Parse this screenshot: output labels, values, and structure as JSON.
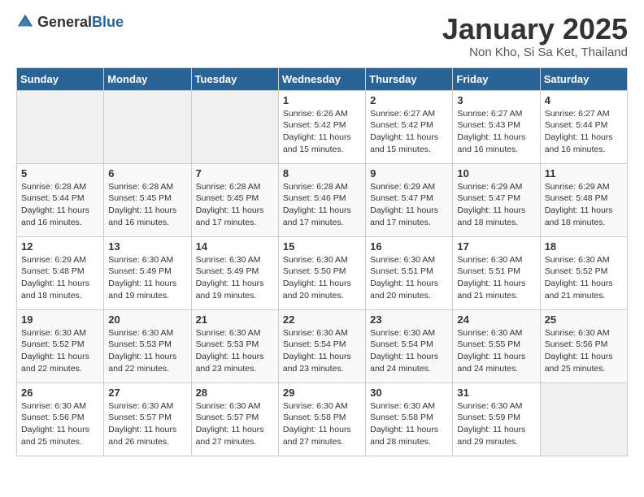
{
  "logo": {
    "general": "General",
    "blue": "Blue"
  },
  "title": "January 2025",
  "subtitle": "Non Kho, Si Sa Ket, Thailand",
  "days_of_week": [
    "Sunday",
    "Monday",
    "Tuesday",
    "Wednesday",
    "Thursday",
    "Friday",
    "Saturday"
  ],
  "weeks": [
    [
      {
        "day": "",
        "info": ""
      },
      {
        "day": "",
        "info": ""
      },
      {
        "day": "",
        "info": ""
      },
      {
        "day": "1",
        "info": "Sunrise: 6:26 AM\nSunset: 5:42 PM\nDaylight: 11 hours and 15 minutes."
      },
      {
        "day": "2",
        "info": "Sunrise: 6:27 AM\nSunset: 5:42 PM\nDaylight: 11 hours and 15 minutes."
      },
      {
        "day": "3",
        "info": "Sunrise: 6:27 AM\nSunset: 5:43 PM\nDaylight: 11 hours and 16 minutes."
      },
      {
        "day": "4",
        "info": "Sunrise: 6:27 AM\nSunset: 5:44 PM\nDaylight: 11 hours and 16 minutes."
      }
    ],
    [
      {
        "day": "5",
        "info": "Sunrise: 6:28 AM\nSunset: 5:44 PM\nDaylight: 11 hours and 16 minutes."
      },
      {
        "day": "6",
        "info": "Sunrise: 6:28 AM\nSunset: 5:45 PM\nDaylight: 11 hours and 16 minutes."
      },
      {
        "day": "7",
        "info": "Sunrise: 6:28 AM\nSunset: 5:45 PM\nDaylight: 11 hours and 17 minutes."
      },
      {
        "day": "8",
        "info": "Sunrise: 6:28 AM\nSunset: 5:46 PM\nDaylight: 11 hours and 17 minutes."
      },
      {
        "day": "9",
        "info": "Sunrise: 6:29 AM\nSunset: 5:47 PM\nDaylight: 11 hours and 17 minutes."
      },
      {
        "day": "10",
        "info": "Sunrise: 6:29 AM\nSunset: 5:47 PM\nDaylight: 11 hours and 18 minutes."
      },
      {
        "day": "11",
        "info": "Sunrise: 6:29 AM\nSunset: 5:48 PM\nDaylight: 11 hours and 18 minutes."
      }
    ],
    [
      {
        "day": "12",
        "info": "Sunrise: 6:29 AM\nSunset: 5:48 PM\nDaylight: 11 hours and 18 minutes."
      },
      {
        "day": "13",
        "info": "Sunrise: 6:30 AM\nSunset: 5:49 PM\nDaylight: 11 hours and 19 minutes."
      },
      {
        "day": "14",
        "info": "Sunrise: 6:30 AM\nSunset: 5:49 PM\nDaylight: 11 hours and 19 minutes."
      },
      {
        "day": "15",
        "info": "Sunrise: 6:30 AM\nSunset: 5:50 PM\nDaylight: 11 hours and 20 minutes."
      },
      {
        "day": "16",
        "info": "Sunrise: 6:30 AM\nSunset: 5:51 PM\nDaylight: 11 hours and 20 minutes."
      },
      {
        "day": "17",
        "info": "Sunrise: 6:30 AM\nSunset: 5:51 PM\nDaylight: 11 hours and 21 minutes."
      },
      {
        "day": "18",
        "info": "Sunrise: 6:30 AM\nSunset: 5:52 PM\nDaylight: 11 hours and 21 minutes."
      }
    ],
    [
      {
        "day": "19",
        "info": "Sunrise: 6:30 AM\nSunset: 5:52 PM\nDaylight: 11 hours and 22 minutes."
      },
      {
        "day": "20",
        "info": "Sunrise: 6:30 AM\nSunset: 5:53 PM\nDaylight: 11 hours and 22 minutes."
      },
      {
        "day": "21",
        "info": "Sunrise: 6:30 AM\nSunset: 5:53 PM\nDaylight: 11 hours and 23 minutes."
      },
      {
        "day": "22",
        "info": "Sunrise: 6:30 AM\nSunset: 5:54 PM\nDaylight: 11 hours and 23 minutes."
      },
      {
        "day": "23",
        "info": "Sunrise: 6:30 AM\nSunset: 5:54 PM\nDaylight: 11 hours and 24 minutes."
      },
      {
        "day": "24",
        "info": "Sunrise: 6:30 AM\nSunset: 5:55 PM\nDaylight: 11 hours and 24 minutes."
      },
      {
        "day": "25",
        "info": "Sunrise: 6:30 AM\nSunset: 5:56 PM\nDaylight: 11 hours and 25 minutes."
      }
    ],
    [
      {
        "day": "26",
        "info": "Sunrise: 6:30 AM\nSunset: 5:56 PM\nDaylight: 11 hours and 25 minutes."
      },
      {
        "day": "27",
        "info": "Sunrise: 6:30 AM\nSunset: 5:57 PM\nDaylight: 11 hours and 26 minutes."
      },
      {
        "day": "28",
        "info": "Sunrise: 6:30 AM\nSunset: 5:57 PM\nDaylight: 11 hours and 27 minutes."
      },
      {
        "day": "29",
        "info": "Sunrise: 6:30 AM\nSunset: 5:58 PM\nDaylight: 11 hours and 27 minutes."
      },
      {
        "day": "30",
        "info": "Sunrise: 6:30 AM\nSunset: 5:58 PM\nDaylight: 11 hours and 28 minutes."
      },
      {
        "day": "31",
        "info": "Sunrise: 6:30 AM\nSunset: 5:59 PM\nDaylight: 11 hours and 29 minutes."
      },
      {
        "day": "",
        "info": ""
      }
    ]
  ]
}
